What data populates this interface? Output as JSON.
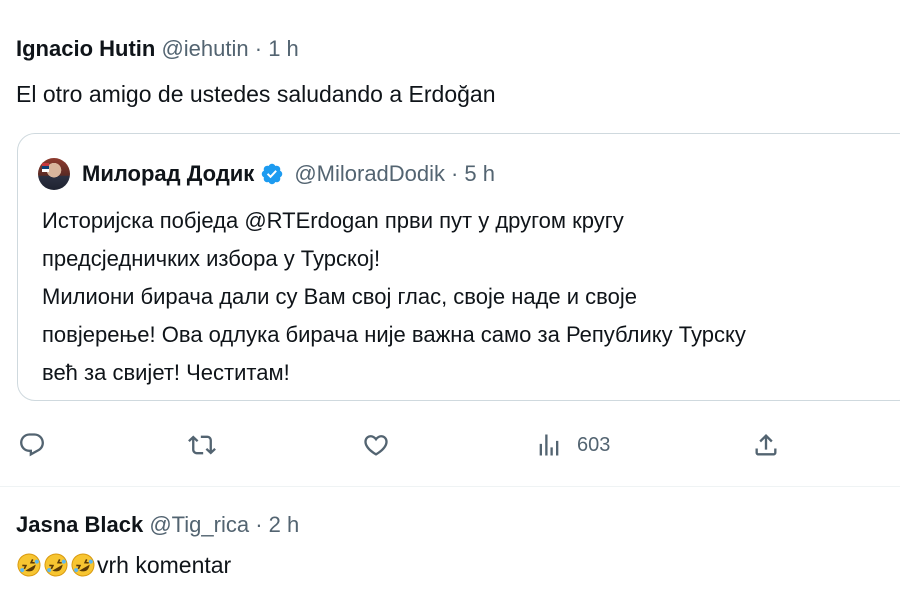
{
  "tweet": {
    "author_name": "Ignacio Hutin",
    "author_handle": "@iehutin",
    "separator": "·",
    "time": "1 h",
    "text": "El otro amigo de ustedes saludando a Erdoğan"
  },
  "quoted_tweet": {
    "author_name": "Милорад Додик",
    "author_handle": "@MiloradDodik",
    "separator": "·",
    "time": "5 h",
    "verified": true,
    "lines": [
      "Историјска побједа  @RTErdogan први пут у другом кругу",
      "предсједничких избора у Турској!",
      "Милиони бирача дали су Вам свој глас, своје наде и своје",
      "повјерење! Ова одлука бирача није важна само за Републику Турску",
      "већ за свијет! Честитам!"
    ]
  },
  "actions": {
    "reply_icon": "reply-icon",
    "retweet_icon": "retweet-icon",
    "like_icon": "heart-icon",
    "views_icon": "views-icon",
    "views_count": "603",
    "share_icon": "share-icon"
  },
  "reply": {
    "author_name": "Jasna Black",
    "author_handle": "@Tig_rica",
    "separator": "·",
    "time": "2 h",
    "emoji": [
      "rolling-on-floor-laughing-emoji",
      "rolling-on-floor-laughing-emoji",
      "rolling-on-floor-laughing-emoji"
    ],
    "text": "vrh komentar"
  },
  "colors": {
    "text": "#0f1419",
    "secondary": "#536471",
    "verified": "#1d9bf0",
    "border": "#cfd9de"
  }
}
